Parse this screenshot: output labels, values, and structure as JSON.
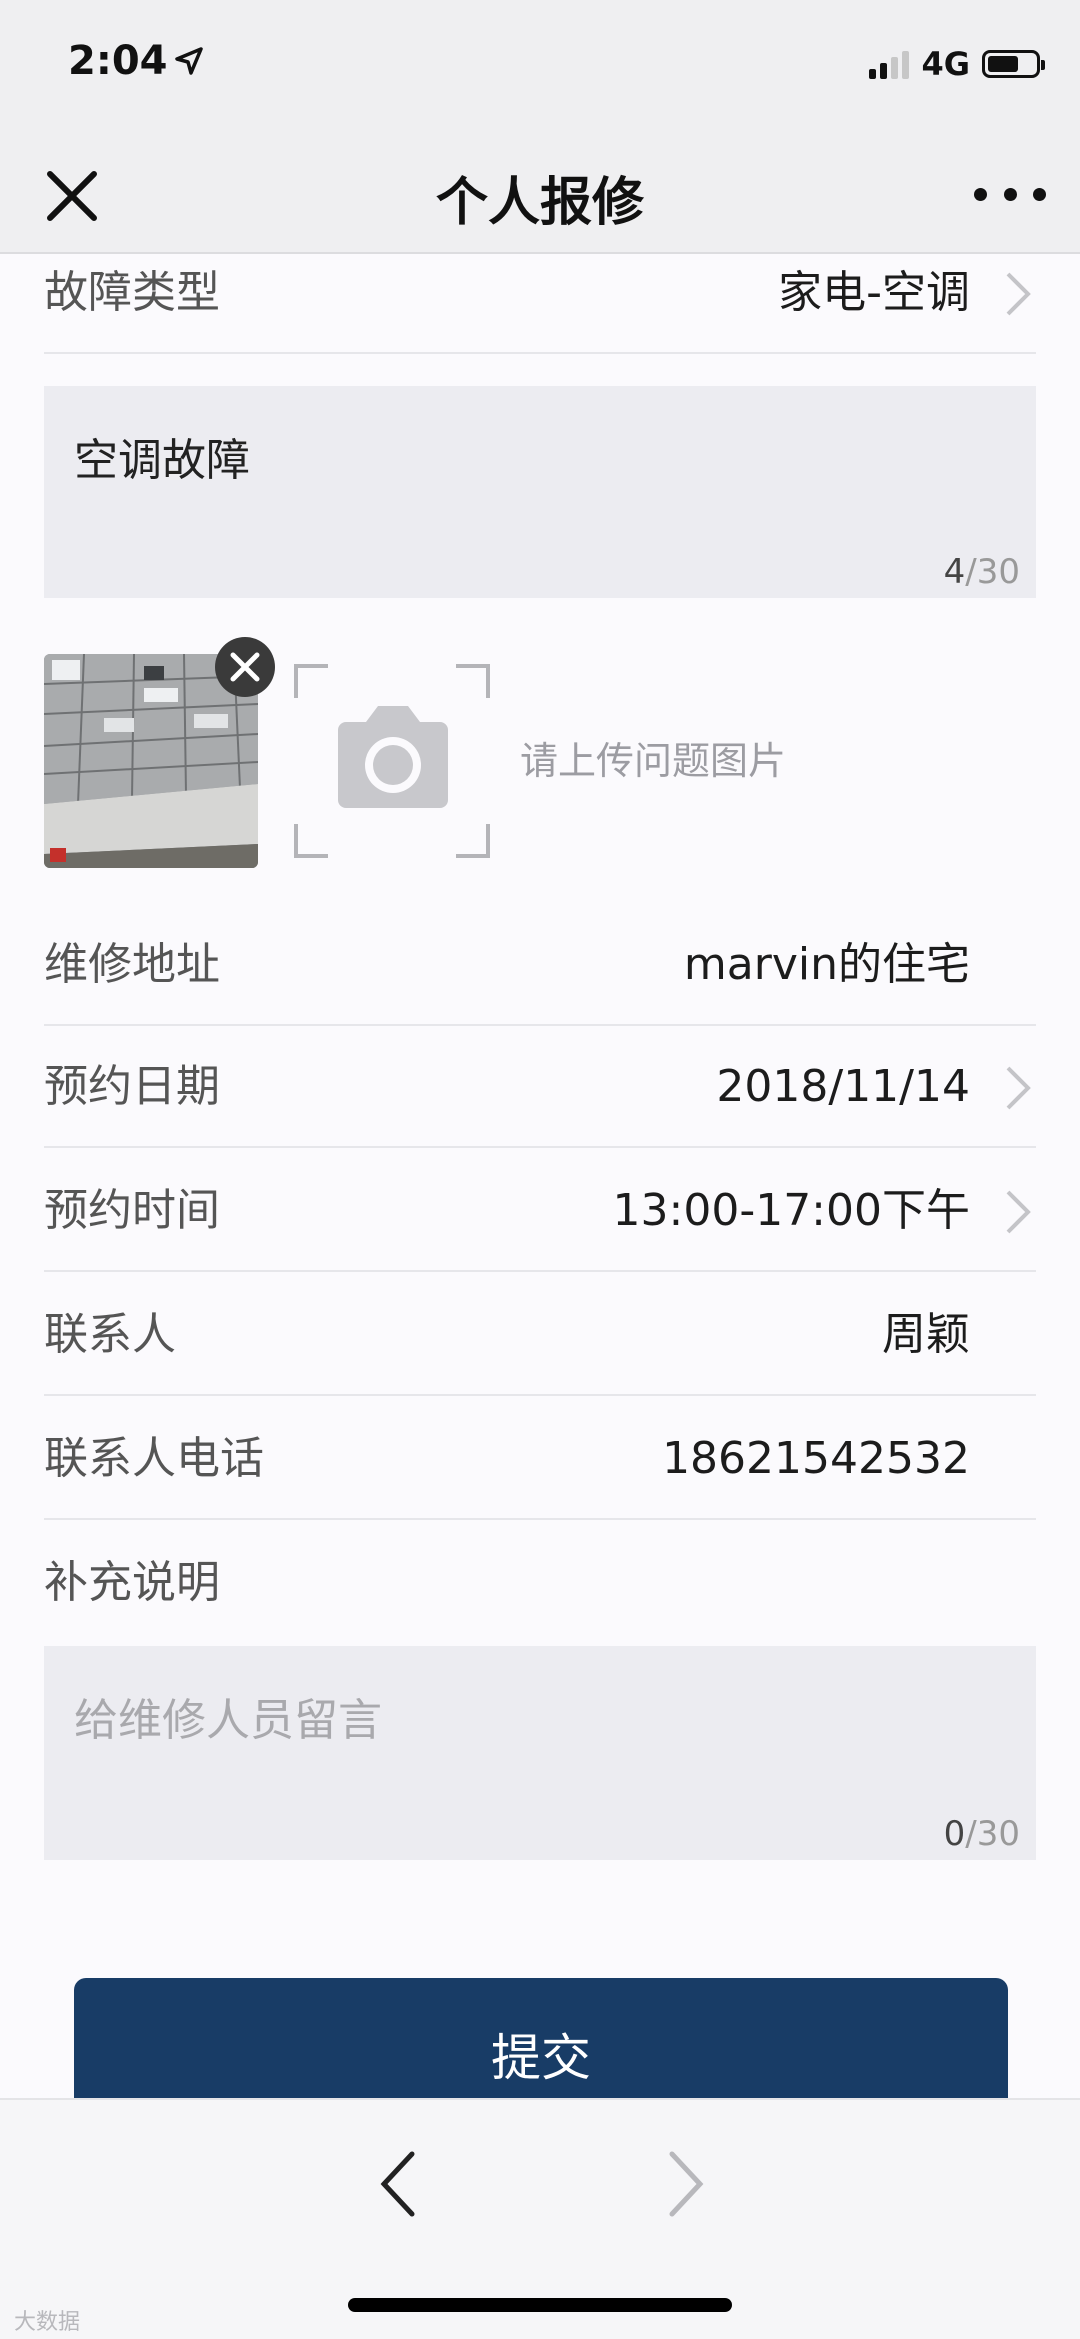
{
  "status_bar": {
    "time": "2:04",
    "network": "4G",
    "location_icon": "location-arrow-icon",
    "signal_icon": "signal-bars-icon",
    "battery_icon": "battery-icon",
    "battery_level": 0.65
  },
  "nav": {
    "title": "个人报修",
    "close_icon": "close-icon",
    "more_icon": "more-icon"
  },
  "form": {
    "fault_type": {
      "label": "故障类型",
      "value": "家电-空调"
    },
    "description": {
      "text": "空调故障",
      "count": "4",
      "max": "/30"
    },
    "upload": {
      "hint": "请上传问题图片",
      "camera_icon": "camera-icon",
      "remove_icon": "remove-photo-icon"
    },
    "address": {
      "label": "维修地址",
      "value": "marvin的住宅"
    },
    "date": {
      "label": "预约日期",
      "value": "2018/11/14"
    },
    "time": {
      "label": "预约时间",
      "value": "13:00-17:00下午"
    },
    "contact": {
      "label": "联系人",
      "value": "周颖"
    },
    "phone": {
      "label": "联系人电话",
      "value": "18621542532"
    },
    "notes": {
      "label": "补充说明",
      "placeholder": "给维修人员留言",
      "count": "0",
      "max": "/30"
    }
  },
  "submit_label": "提交",
  "toolbar": {
    "back_icon": "back-arrow-icon",
    "forward_icon": "forward-arrow-icon"
  },
  "watermark": "大数据",
  "colors": {
    "primary": "#183c66",
    "background": "#fbfafd",
    "input_bg": "#ececf1",
    "nav_bg": "#efeff1"
  }
}
